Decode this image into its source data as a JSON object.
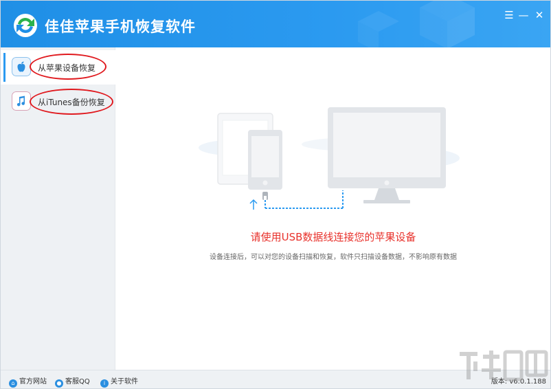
{
  "app": {
    "title": "佳佳苹果手机恢复软件",
    "window_controls": {
      "menu": "☰",
      "minimize": "—",
      "close": "✕"
    }
  },
  "sidebar": {
    "items": [
      {
        "label": "从苹果设备恢复",
        "icon": "apple-icon",
        "active": true
      },
      {
        "label": "从iTunes备份恢复",
        "icon": "itunes-music-icon",
        "active": false
      }
    ]
  },
  "main": {
    "headline": "请使用USB数据线连接您的苹果设备",
    "subline": "设备连接后，可以对您的设备扫描和恢复，软件只扫描设备数据，不影响原有数据"
  },
  "statusbar": {
    "links": [
      {
        "label": "官方网站",
        "icon": "home-icon"
      },
      {
        "label": "客服QQ",
        "icon": "qq-icon"
      },
      {
        "label": "关于软件",
        "icon": "info-icon"
      }
    ],
    "version": "版本: v6.0.1.188"
  },
  "colors": {
    "accent": "#2b9af0",
    "headline": "#e8312b",
    "annotation": "#e0191e",
    "sidebar_bg": "#eef1f4"
  }
}
